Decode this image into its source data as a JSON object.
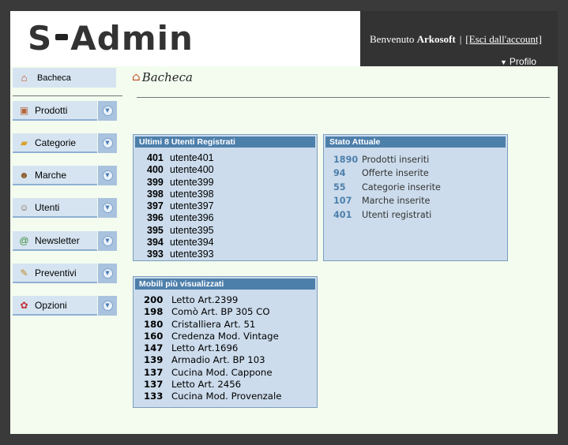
{
  "header": {
    "logo_text_a": "S",
    "logo_text_b": "Admin",
    "welcome_prefix": "Benvenuto",
    "username": "Arkosoft",
    "separator": "|",
    "logout_label": "[Esci dall'account]",
    "profile_label": "Profilo"
  },
  "sidebar": {
    "dashboard_label": "Bacheca",
    "items": [
      {
        "label": "Prodotti",
        "icon": "box-icon"
      },
      {
        "label": "Categorie",
        "icon": "folder-icon"
      },
      {
        "label": "Marche",
        "icon": "users-icon"
      },
      {
        "label": "Utenti",
        "icon": "user-icon"
      },
      {
        "label": "Newsletter",
        "icon": "email-icon"
      },
      {
        "label": "Preventivi",
        "icon": "edit-icon"
      },
      {
        "label": "Opzioni",
        "icon": "settings-icon"
      }
    ]
  },
  "main": {
    "title": "Bacheca",
    "users_box": {
      "title": "Ultimi 8 Utenti Registrati",
      "rows": [
        {
          "id": "401",
          "name": "utente401"
        },
        {
          "id": "400",
          "name": "utente400"
        },
        {
          "id": "399",
          "name": "utente399"
        },
        {
          "id": "398",
          "name": "utente398"
        },
        {
          "id": "397",
          "name": "utente397"
        },
        {
          "id": "396",
          "name": "utente396"
        },
        {
          "id": "395",
          "name": "utente395"
        },
        {
          "id": "394",
          "name": "utente394"
        },
        {
          "id": "393",
          "name": "utente393"
        }
      ]
    },
    "stato_box": {
      "title": "Stato Attuale",
      "rows": [
        {
          "count": "1890",
          "label": "Prodotti inseriti"
        },
        {
          "count": "94",
          "label": "Offerte inserite"
        },
        {
          "count": "55",
          "label": "Categorie inserite"
        },
        {
          "count": "107",
          "label": "Marche inserite"
        },
        {
          "count": "401",
          "label": "Utenti registrati"
        }
      ]
    },
    "mobili_box": {
      "title": "Mobili più visualizzati",
      "rows": [
        {
          "views": "200",
          "name": "Letto Art.2399"
        },
        {
          "views": "198",
          "name": "Comò Art. BP 305 CO"
        },
        {
          "views": "180",
          "name": "Cristalliera Art. 51"
        },
        {
          "views": "160",
          "name": "Credenza Mod. Vintage"
        },
        {
          "views": "147",
          "name": "Letto Art.1696"
        },
        {
          "views": "139",
          "name": "Armadio Art. BP 103"
        },
        {
          "views": "137",
          "name": "Cucina Mod. Cappone"
        },
        {
          "views": "137",
          "name": "Letto Art. 2456"
        },
        {
          "views": "133",
          "name": "Cucina Mod. Provenzale"
        }
      ]
    }
  },
  "colors": {
    "header_dark": "#333333",
    "frame_bg": "#f3fcef",
    "panel_bg": "#ccdcec",
    "panel_header": "#4d7fab",
    "sidebar_bg": "#d6e4f1"
  }
}
